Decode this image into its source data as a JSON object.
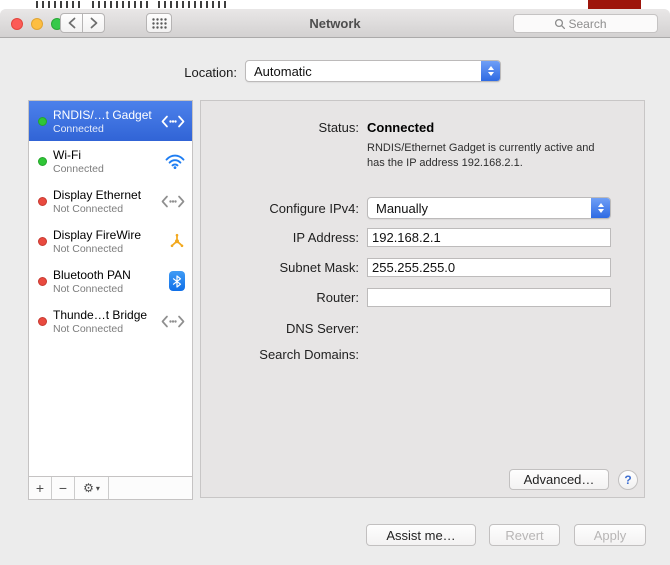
{
  "colors": {
    "selection_blue": "#3b6fe0",
    "popup_cap_blue": "#3a74ec",
    "connected_dot_green": "#2fc636",
    "disconnected_dot_red": "#e94a3f",
    "wifi_blue": "#1e7df2",
    "firewire_yellow": "#f2a81d",
    "bluetooth_blue": "#1a7ff0"
  },
  "titlebar": {
    "title": "Network",
    "search_placeholder": "Search"
  },
  "location": {
    "label": "Location:",
    "value": "Automatic"
  },
  "sidebar": {
    "items": [
      {
        "name": "RNDIS/…t Gadget",
        "status": "Connected",
        "dot": "green",
        "icon": "ethernet-icon",
        "selected": true
      },
      {
        "name": "Wi-Fi",
        "status": "Connected",
        "dot": "green",
        "icon": "wifi-icon",
        "selected": false
      },
      {
        "name": "Display Ethernet",
        "status": "Not Connected",
        "dot": "red",
        "icon": "ethernet-icon",
        "selected": false
      },
      {
        "name": "Display FireWire",
        "status": "Not Connected",
        "dot": "red",
        "icon": "firewire-icon",
        "selected": false
      },
      {
        "name": "Bluetooth PAN",
        "status": "Not Connected",
        "dot": "red",
        "icon": "bluetooth-icon",
        "selected": false
      },
      {
        "name": "Thunde…t Bridge",
        "status": "Not Connected",
        "dot": "red",
        "icon": "ethernet-icon",
        "selected": false
      }
    ],
    "toolbar": {
      "add": "+",
      "remove": "−",
      "gear": "⚙",
      "gear_arrow": "▾"
    }
  },
  "panel": {
    "status_label": "Status:",
    "status_value": "Connected",
    "status_note": "RNDIS/Ethernet Gadget is currently active and has the IP address 192.168.2.1.",
    "configure_label": "Configure IPv4:",
    "configure_value": "Manually",
    "ip_label": "IP Address:",
    "ip_value": "192.168.2.1",
    "subnet_label": "Subnet Mask:",
    "subnet_value": "255.255.255.0",
    "router_label": "Router:",
    "router_value": "",
    "dns_label": "DNS Server:",
    "search_domains_label": "Search Domains:",
    "advanced_button": "Advanced…",
    "help_button": "?"
  },
  "footer": {
    "assist_button": "Assist me…",
    "revert_button": "Revert",
    "apply_button": "Apply"
  }
}
